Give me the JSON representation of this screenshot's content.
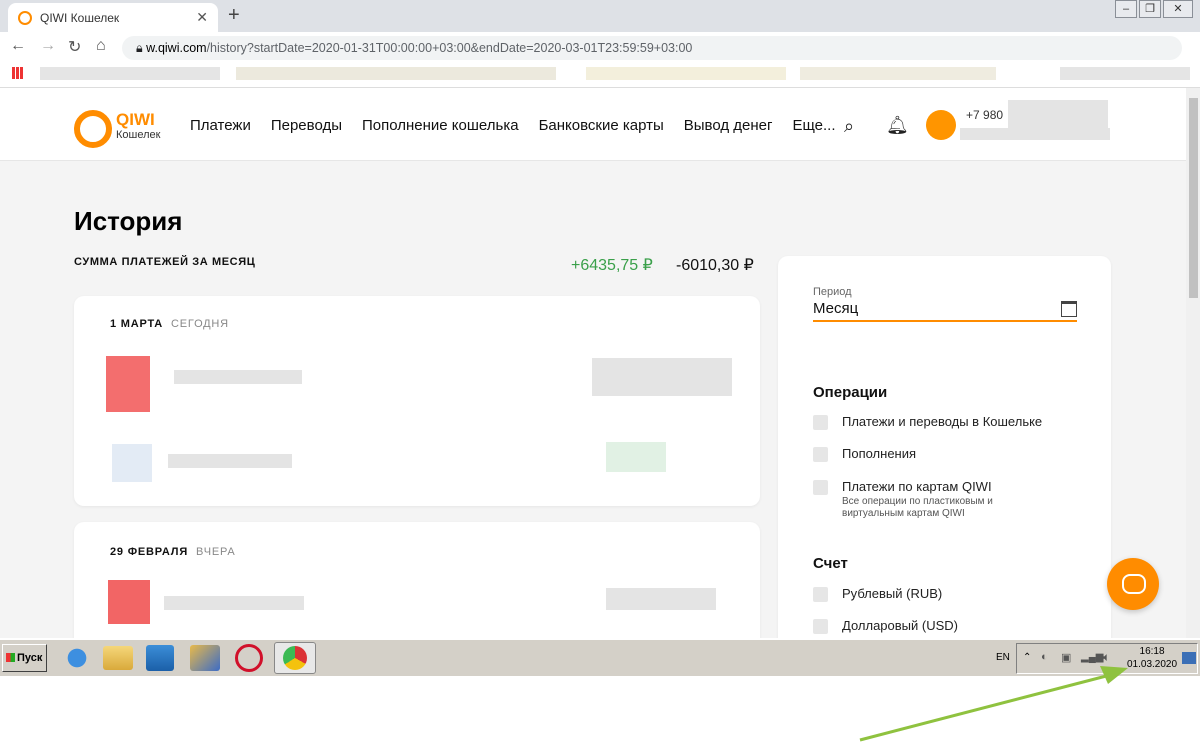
{
  "browser": {
    "tab_title": "QIWI Кошелек",
    "url_host": "w.qiwi.com",
    "url_rest": "/history?startDate=2020-01-31T00:00:00+03:00&endDate=2020-03-01T23:59:59+03:00"
  },
  "site": {
    "logo_title": "QIWI",
    "logo_sub": "Кошелек",
    "nav": [
      "Платежи",
      "Переводы",
      "Пополнение кошелька",
      "Банковские карты",
      "Вывод денег",
      "Еще..."
    ],
    "phone": "+7 980",
    "page_title": "История",
    "sum_label": "СУММА ПЛАТЕЖЕЙ ЗА МЕСЯЦ",
    "sum_plus": "+6435,75 ₽",
    "sum_minus": "-6010,30 ₽",
    "groups": [
      {
        "date": "1 МАРТА",
        "rel": "СЕГОДНЯ"
      },
      {
        "date": "29 ФЕВРАЛЯ",
        "rel": "ВЧЕРА"
      }
    ],
    "filters": {
      "period_label": "Период",
      "period_value": "Месяц",
      "ops_title": "Операции",
      "ops": [
        "Платежи и переводы в Кошельке",
        "Пополнения",
        "Платежи по картам QIWI"
      ],
      "ops_note": "Все операции по пластиковым и виртуальным картам QIWI",
      "acc_title": "Счет",
      "accounts": [
        "Рублевый (RUB)",
        "Долларовый (USD)"
      ]
    }
  },
  "taskbar": {
    "start": "Пуск",
    "lang": "EN",
    "time": "16:18",
    "date": "01.03.2020"
  },
  "colors": {
    "accent": "#ff8c00",
    "positive": "#3aa04a",
    "annotation_arrow": "#8fc23f"
  }
}
